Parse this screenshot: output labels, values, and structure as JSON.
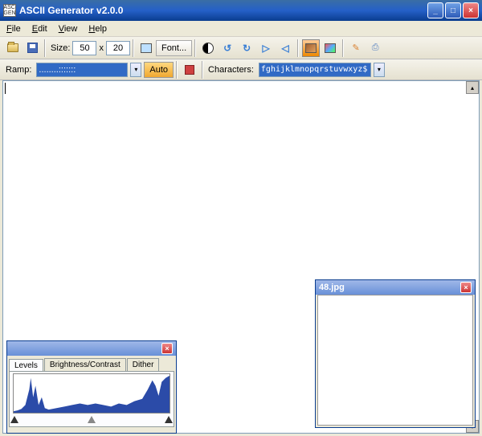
{
  "window": {
    "title": "ASCII Generator v2.0.0",
    "icon_text": "ASC\nGEN"
  },
  "menubar": {
    "file": "File",
    "edit": "Edit",
    "view": "View",
    "help": "Help"
  },
  "toolbar": {
    "size_label": "Size:",
    "width": "50",
    "x": "x",
    "height": "20",
    "font_label": "Font..."
  },
  "toolbar2": {
    "ramp_label": "Ramp:",
    "ramp_value": "........:::::::",
    "auto_label": "Auto",
    "chars_label": "Characters:",
    "chars_value": "fghijklmnopqrstuvwxyz$"
  },
  "levels_panel": {
    "tabs": [
      "Levels",
      "Brightness/Contrast",
      "Dither"
    ]
  },
  "image_panel": {
    "title": "48.jpg"
  },
  "winbtns": {
    "min": "_",
    "max": "□",
    "close": "×"
  }
}
